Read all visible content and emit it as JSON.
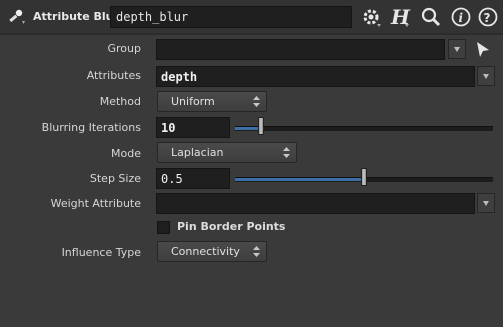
{
  "header": {
    "node_type": "Attribute Blur",
    "node_name": "depth_blur",
    "icons": [
      "gear-icon",
      "help-h-icon",
      "search-icon",
      "info-icon",
      "question-icon"
    ]
  },
  "params": {
    "group": {
      "label": "Group",
      "value": ""
    },
    "attributes": {
      "label": "Attributes",
      "value": "depth"
    },
    "method": {
      "label": "Method",
      "value": "Uniform"
    },
    "iterations": {
      "label": "Blurring Iterations",
      "value": "10",
      "slider_fraction": 0.1
    },
    "mode": {
      "label": "Mode",
      "value": "Laplacian"
    },
    "step_size": {
      "label": "Step Size",
      "value": "0.5",
      "slider_fraction": 0.5
    },
    "weight_attribute": {
      "label": "Weight Attribute",
      "value": ""
    },
    "pin_border": {
      "label": "Pin Border Points",
      "checked": false
    },
    "influence_type": {
      "label": "Influence Type",
      "value": "Connectivity"
    }
  },
  "colors": {
    "accent": "#3d6fa6",
    "background": "#3a3a3a"
  }
}
